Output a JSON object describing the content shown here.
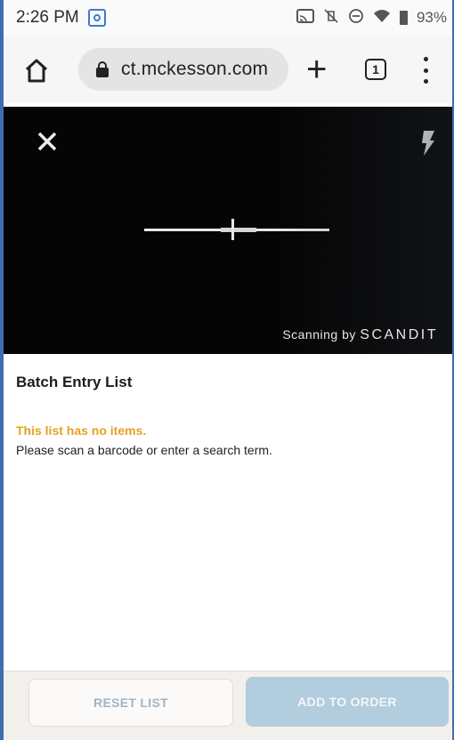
{
  "status_bar": {
    "time": "2:26 PM",
    "battery_percent": "93%",
    "icons": [
      "app-notification-icon",
      "cast-icon",
      "vibrate-off-icon",
      "do-not-disturb-icon",
      "wifi-icon",
      "battery-icon"
    ]
  },
  "browser": {
    "url": "ct.mckesson.com",
    "tab_count": "1",
    "icons": [
      "home-icon",
      "lock-icon",
      "plus-icon",
      "tabs-icon",
      "more-vert-icon"
    ]
  },
  "scanner": {
    "credit_prefix": "Scanning by",
    "credit_brand": "SCANDIT",
    "icons": [
      "close-icon",
      "flash-icon"
    ]
  },
  "batch_list": {
    "title": "Batch Entry List",
    "empty_title": "This list has no items.",
    "empty_message": "Please scan a barcode or enter a search term."
  },
  "footer": {
    "reset_label": "RESET LIST",
    "add_label": "ADD TO ORDER"
  },
  "colors": {
    "accent_orange": "#e8a021",
    "button_disabled_blue": "#b2cddd",
    "frame_blue": "#3d6fb0"
  }
}
